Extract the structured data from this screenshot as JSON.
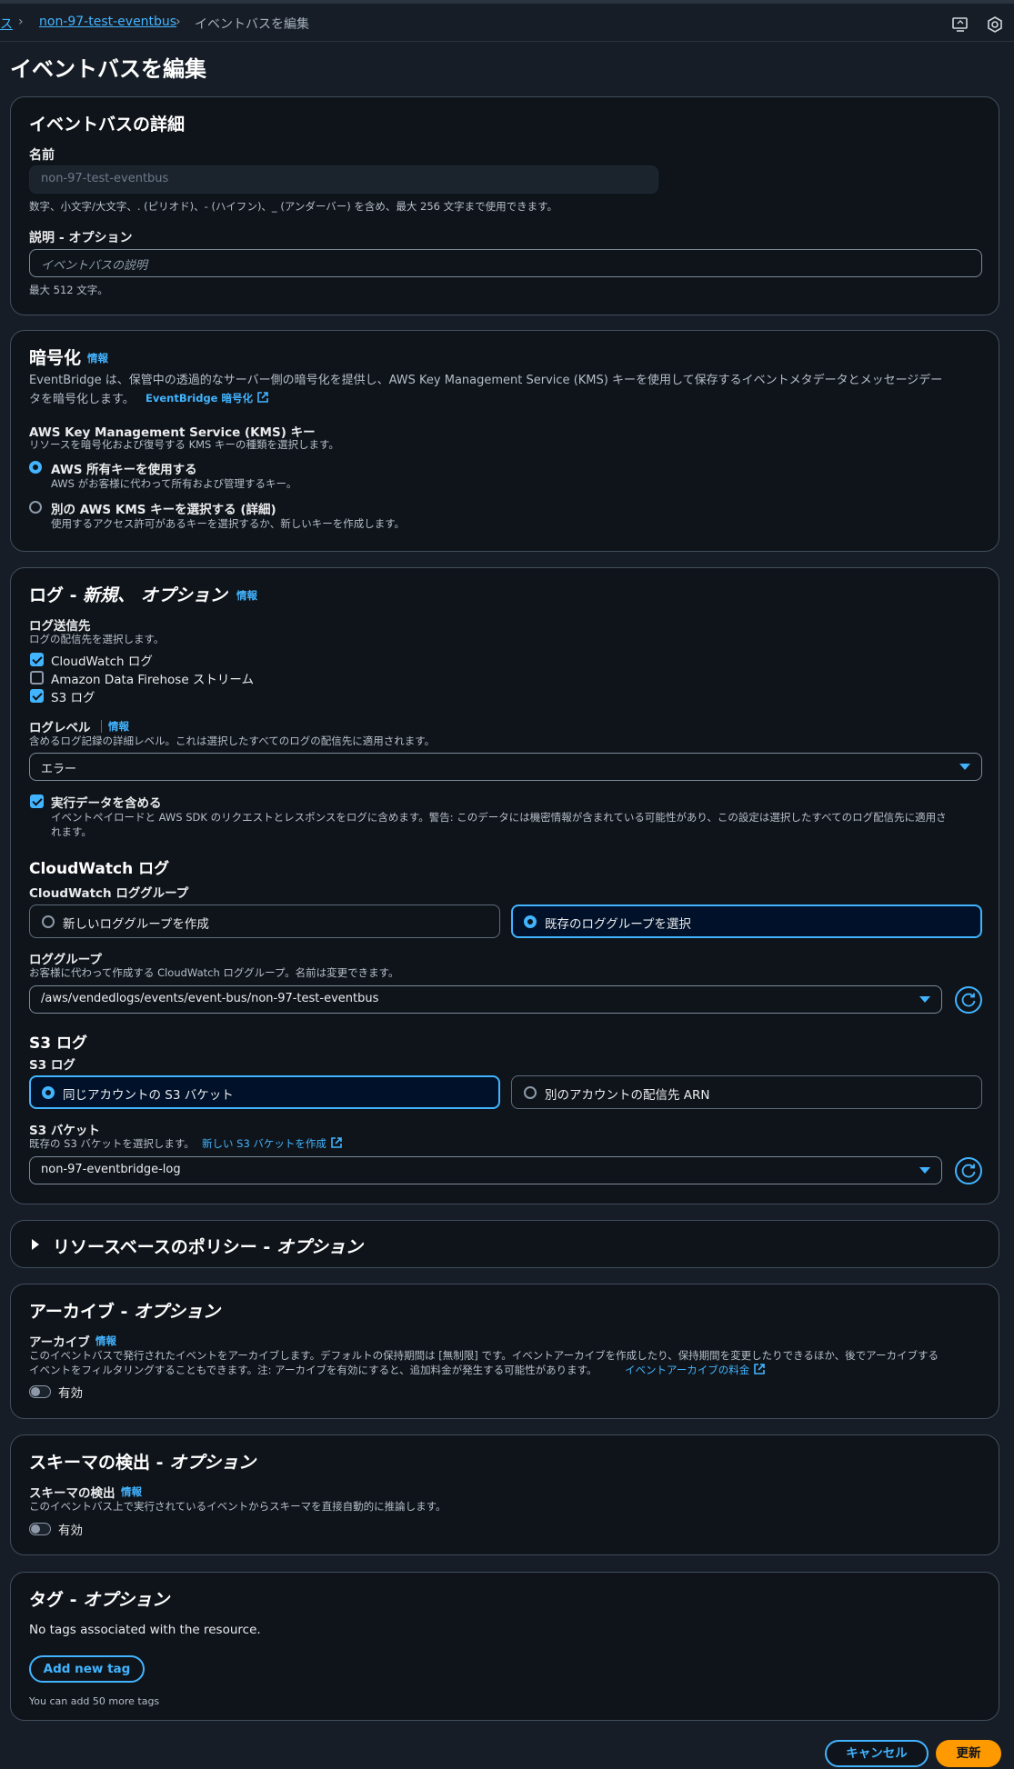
{
  "breadcrumb": {
    "parent": "ス",
    "bus": "non-97-test-eventbus",
    "current": "イベントバスを編集"
  },
  "page_title": "イベントバスを編集",
  "details": {
    "heading": "イベントバスの詳細",
    "name_label": "名前",
    "name_value": "non-97-test-eventbus",
    "name_hint": "数字、小文字/大文字、. (ピリオド)、- (ハイフン)、_ (アンダーバー) を含め、最大 256 文字まで使用できます。",
    "desc_label": "説明 - オプション",
    "desc_placeholder": "イベントバスの説明",
    "desc_hint": "最大 512 文字。"
  },
  "encryption": {
    "heading": "暗号化",
    "info": "情報",
    "desc_line1": "EventBridge は、保管中の透過的なサーバー側の暗号化を提供し、AWS Key Management Service (KMS) キーを使用して保存するイベントメタデータとメッセージデー",
    "desc_line2": "タを暗号化します。",
    "link": "EventBridge 暗号化",
    "kms_label": "AWS Key Management Service (KMS) キー",
    "kms_desc": "リソースを暗号化および復号する KMS キーの種類を選択します。",
    "option1_label": "AWS 所有キーを使用する",
    "option1_desc": "AWS がお客様に代わって所有および管理するキー。",
    "option2_label": "別の AWS KMS キーを選択する (詳細)",
    "option2_desc": "使用するアクセス許可があるキーを選択するか、新しいキーを作成します。"
  },
  "logs": {
    "heading_prefix": "ログ - ",
    "heading_em": "新規、 オプション",
    "info": "情報",
    "dest_label": "ログ送信先",
    "dest_desc": "ログの配信先を選択します。",
    "dest_cloudwatch": "CloudWatch ログ",
    "dest_firehose": "Amazon Data Firehose ストリーム",
    "dest_s3": "S3 ログ",
    "level_label": "ログレベル",
    "level_info": "情報",
    "level_desc": "含めるログ記録の詳細レベル。これは選択したすべてのログの配信先に適用されます。",
    "level_value": "エラー",
    "exec_label": "実行データを含める",
    "exec_desc1": "イベントペイロードと AWS SDK のリクエストとレスポンスをログに含めます。警告: このデータには機密情報が含まれている可能性があり、この設定は選択したすべてのログ配信先に適用さ",
    "exec_desc2": "れます。",
    "cw_heading": "CloudWatch ログ",
    "cw_group_label": "CloudWatch ロググループ",
    "cw_opt_new": "新しいロググループを作成",
    "cw_opt_existing": "既存のロググループを選択",
    "lg_label": "ロググループ",
    "lg_desc": "お客様に代わって作成する CloudWatch ロググループ。名前は変更できます。",
    "lg_value": "/aws/vendedlogs/events/event-bus/non-97-test-eventbus",
    "s3_heading": "S3 ログ",
    "s3_label": "S3 ログ",
    "s3_opt_same": "同じアカウントの S3 バケット",
    "s3_opt_other": "別のアカウントの配信先 ARN",
    "bucket_label": "S3 バケット",
    "bucket_desc": "既存の S3 バケットを選択します。",
    "bucket_link": "新しい S3 バケットを作成",
    "bucket_value": "non-97-eventbridge-log"
  },
  "policy": {
    "heading_prefix": "リソースベースのポリシー - ",
    "heading_em": "オプション"
  },
  "archive": {
    "heading_prefix": "アーカイブ - ",
    "heading_em": "オプション",
    "label": "アーカイブ",
    "info": "情報",
    "desc1": "このイベントバスで発行されたイベントをアーカイブします。デフォルトの保持期間は [無制限] です。イベントアーカイブを作成したり、保持期間を変更したりできるほか、後でアーカイブする",
    "desc2": "イベントをフィルタリングすることもできます。注: アーカイブを有効にすると、追加料金が発生する可能性があります。",
    "link": "イベントアーカイブの料金",
    "toggle_label": "有効"
  },
  "schema": {
    "heading_prefix": "スキーマの検出 - ",
    "heading_em": "オプション",
    "label": "スキーマの検出",
    "info": "情報",
    "desc": "このイベントバス上で実行されているイベントからスキーマを直接自動的に推論します。",
    "toggle_label": "有効"
  },
  "tags": {
    "heading_prefix": "タグ - ",
    "heading_em": "オプション",
    "empty": "No tags associated with the resource.",
    "add_button": "Add new tag",
    "hint": "You can add 50 more tags"
  },
  "footer": {
    "cancel": "キャンセル",
    "submit": "更新"
  },
  "colors": {
    "accent": "#42b4ff",
    "primary": "#ff9900",
    "panel_bg": "#0f141a",
    "page_bg": "#161d26"
  }
}
